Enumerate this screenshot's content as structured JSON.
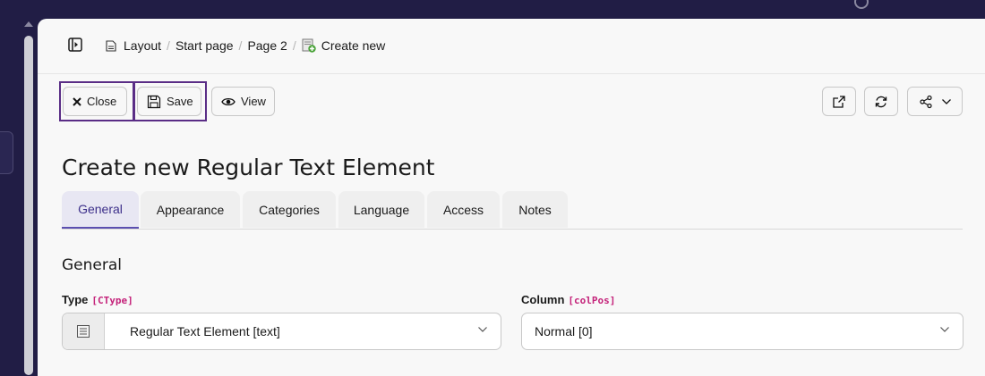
{
  "breadcrumb": {
    "items": [
      "Layout",
      "Start page",
      "Page 2"
    ],
    "current": "Create new"
  },
  "toolbar": {
    "close_label": "Close",
    "save_label": "Save",
    "view_label": "View"
  },
  "page_title": "Create new Regular Text Element",
  "tabs": [
    {
      "label": "General",
      "active": true
    },
    {
      "label": "Appearance"
    },
    {
      "label": "Categories"
    },
    {
      "label": "Language"
    },
    {
      "label": "Access"
    },
    {
      "label": "Notes"
    }
  ],
  "section_title": "General",
  "fields": {
    "type": {
      "label": "Type",
      "key": "[CType]",
      "value": "Regular Text Element [text]"
    },
    "column": {
      "label": "Column",
      "key": "[colPos]",
      "value": "Normal [0]"
    }
  },
  "colors": {
    "accent": "#5b4fb0",
    "highlight_border": "#5a2d86",
    "field_key": "#c4227a",
    "frame": "#211d45"
  }
}
